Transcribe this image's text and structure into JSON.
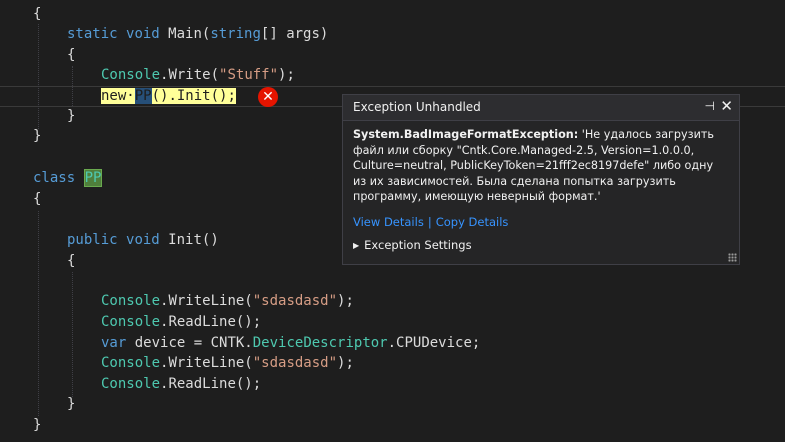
{
  "code": {
    "l1_brace": "{",
    "l2_kw1": "static",
    "l2_kw2": "void",
    "l2_name": "Main(",
    "l2_type": "string",
    "l2_rest": "[] args)",
    "l3_brace": "{",
    "l4_class": "Console",
    "l4_method": ".Write(",
    "l4_str": "\"Stuff\"",
    "l4_end": ");",
    "l5_new": "new",
    "l5_dot": "·",
    "l5_type": "PP",
    "l5_rest": "().Init();",
    "l6_brace": "}",
    "l7_brace": "}",
    "l8_kw": "class",
    "l8_type": "PP",
    "l9_brace": "{",
    "l10_kw1": "public",
    "l10_kw2": "void",
    "l10_name": "Init()",
    "l11_brace": "{",
    "l12_class": "Console",
    "l12_method": ".WriteLine(",
    "l12_str": "\"sdasdasd\"",
    "l12_end": ");",
    "l13_class": "Console",
    "l13_rest": ".ReadLine();",
    "l14_kw": "var",
    "l14_mid": "device = CNTK.",
    "l14_type": "DeviceDescriptor",
    "l14_rest": ".CPUDevice;",
    "l15_class": "Console",
    "l15_method": ".WriteLine(",
    "l15_str": "\"sdasdasd\"",
    "l15_end": ");",
    "l16_class": "Console",
    "l16_rest": ".ReadLine();",
    "l17_brace": "}",
    "l18_brace": "}"
  },
  "error_glyph": "✕",
  "popup": {
    "title": "Exception Unhandled",
    "pin_glyph": "⊣",
    "close_glyph": "✕",
    "exception_type": "System.BadImageFormatException:",
    "message": " 'Не удалось загрузить файл или сборку \"Cntk.Core.Managed-2.5, Version=1.0.0.0, Culture=neutral, PublicKeyToken=21fff2ec8197defe\" либо одну из их зависимостей. Была сделана попытка загрузить программу, имеющую неверный формат.'",
    "view_details": "View Details",
    "separator": "|",
    "copy_details": "Copy Details",
    "settings_arrow": "▶",
    "settings_label": "Exception Settings"
  },
  "colors": {
    "background": "#1e1e1e",
    "keyword": "#569cd6",
    "type": "#4ec9b0",
    "string": "#d69d85",
    "link": "#3794ff",
    "error": "#e51400"
  }
}
